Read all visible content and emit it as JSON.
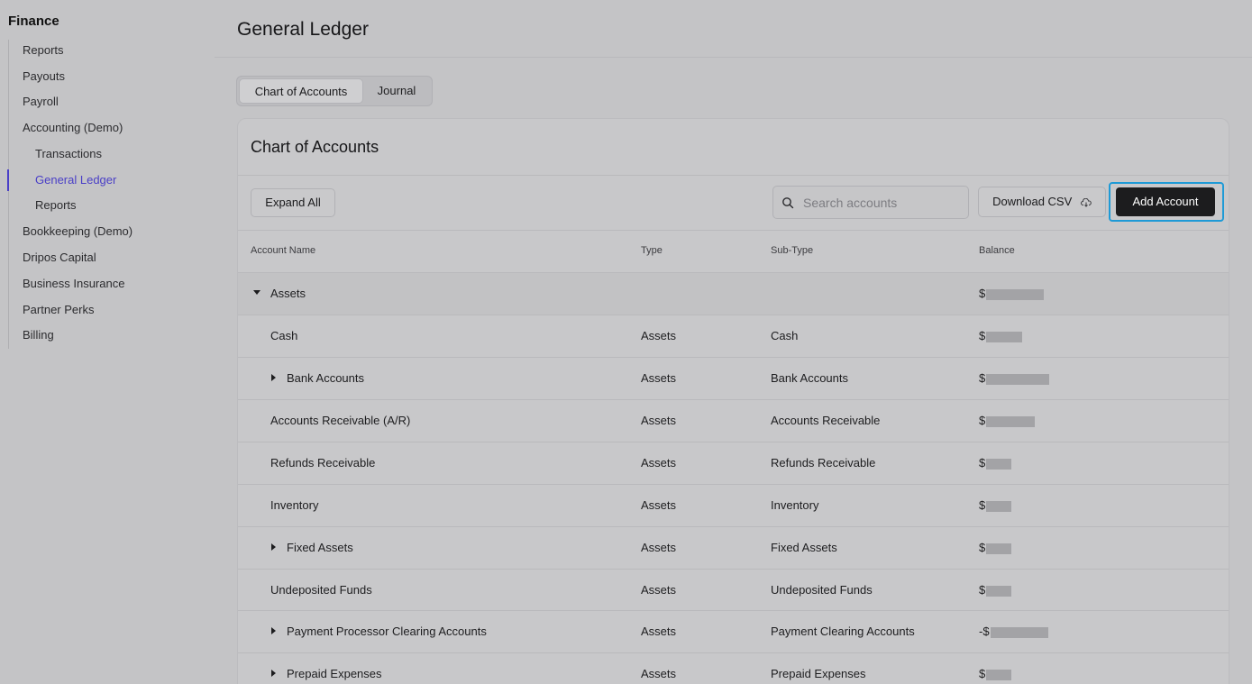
{
  "sidebar": {
    "title": "Finance",
    "items": [
      {
        "label": "Reports"
      },
      {
        "label": "Payouts"
      },
      {
        "label": "Payroll"
      },
      {
        "label": "Accounting (Demo)"
      },
      {
        "label": "Transactions"
      },
      {
        "label": "General Ledger"
      },
      {
        "label": "Reports"
      },
      {
        "label": "Bookkeeping (Demo)"
      },
      {
        "label": "Dripos Capital"
      },
      {
        "label": "Business Insurance"
      },
      {
        "label": "Partner Perks"
      },
      {
        "label": "Billing"
      }
    ],
    "active_item": "General Ledger"
  },
  "header": {
    "title": "General Ledger"
  },
  "tabs": [
    {
      "label": "Chart of Accounts",
      "selected": true
    },
    {
      "label": "Journal",
      "selected": false
    }
  ],
  "card": {
    "title": "Chart of Accounts",
    "expand_label": "Expand All",
    "search_placeholder": "Search accounts",
    "download_label": "Download CSV",
    "add_label": "Add Account"
  },
  "table": {
    "columns": [
      "Account Name",
      "Type",
      "Sub-Type",
      "Balance"
    ],
    "rows": [
      {
        "name": "Assets",
        "type": "",
        "subtype": "",
        "balance_prefix": "$",
        "expandable": true,
        "expanded": true,
        "level": 0
      },
      {
        "name": "Cash",
        "type": "Assets",
        "subtype": "Cash",
        "balance_prefix": "$",
        "expandable": false,
        "level": 1
      },
      {
        "name": "Bank Accounts",
        "type": "Assets",
        "subtype": "Bank Accounts",
        "balance_prefix": "$",
        "expandable": true,
        "expanded": false,
        "level": 1
      },
      {
        "name": "Accounts Receivable (A/R)",
        "type": "Assets",
        "subtype": "Accounts Receivable",
        "balance_prefix": "$",
        "expandable": false,
        "level": 1
      },
      {
        "name": "Refunds Receivable",
        "type": "Assets",
        "subtype": "Refunds Receivable",
        "balance_prefix": "$",
        "expandable": false,
        "level": 1
      },
      {
        "name": "Inventory",
        "type": "Assets",
        "subtype": "Inventory",
        "balance_prefix": "$",
        "expandable": false,
        "level": 1
      },
      {
        "name": "Fixed Assets",
        "type": "Assets",
        "subtype": "Fixed Assets",
        "balance_prefix": "$",
        "expandable": true,
        "expanded": false,
        "level": 1
      },
      {
        "name": "Undeposited Funds",
        "type": "Assets",
        "subtype": "Undeposited Funds",
        "balance_prefix": "$",
        "expandable": false,
        "level": 1
      },
      {
        "name": "Payment Processor Clearing Accounts",
        "type": "Assets",
        "subtype": "Payment Clearing Accounts",
        "balance_prefix": "-$",
        "expandable": true,
        "expanded": false,
        "level": 1
      },
      {
        "name": "Prepaid Expenses",
        "type": "Assets",
        "subtype": "Prepaid Expenses",
        "balance_prefix": "$",
        "expandable": true,
        "expanded": false,
        "level": 1
      }
    ]
  },
  "colors": {
    "accent": "#4a3fc7",
    "focus_ring": "#1e9ad6",
    "primary_button": "#1c1c1e"
  }
}
